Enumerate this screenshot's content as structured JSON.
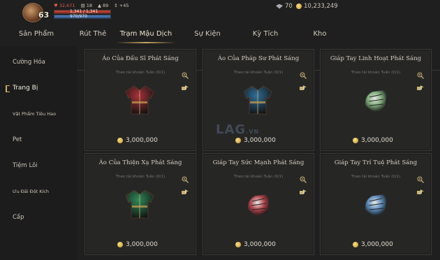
{
  "player": {
    "level": "63",
    "power": "32,671",
    "stat_a": "18",
    "stat_b": "89",
    "stat_c": "+45",
    "hp": "1,341 / 1,341",
    "mp": "970/970",
    "hp_fraction": 1.0,
    "mp_fraction": 1.0
  },
  "currency": {
    "gems": "70",
    "gold": "10,233,249"
  },
  "tabs": [
    {
      "label": "Sản Phẩm"
    },
    {
      "label": "Rút Thẻ"
    },
    {
      "label": "Trạm Mậu Dịch"
    },
    {
      "label": "Sự Kiện"
    },
    {
      "label": "Kỳ Tích"
    },
    {
      "label": "Kho"
    }
  ],
  "active_tab": "Trạm Mậu Dịch",
  "sidebar": {
    "items": [
      {
        "label": "Cường Hóa"
      },
      {
        "label": "Trang Bị"
      },
      {
        "label": "Vật Phẩm Tiêu Hao"
      },
      {
        "label": "Pet"
      },
      {
        "label": "Tiệm Lõi"
      },
      {
        "label": "Ưu Đãi Đột Kích"
      },
      {
        "label": "Cấp"
      }
    ],
    "active": "Trang Bị"
  },
  "items": [
    {
      "name": "Áo Của Đấu Sĩ Phát Sáng",
      "limit": "Theo tài khoản Tuần (0/1)",
      "price": "3,000,000",
      "kind": "robe",
      "color": "#a8323a"
    },
    {
      "name": "Áo Của Pháp Sư Phát Sáng",
      "limit": "Theo tài khoản Tuần (0/1)",
      "price": "3,000,000",
      "kind": "robe",
      "color": "#2f6e98"
    },
    {
      "name": "Giáp Tay Linh Hoạt Phát Sáng",
      "limit": "Theo tài khoản Tuần (0/1)",
      "price": "3,000,000",
      "kind": "gauntlet",
      "color": "#7faa7a"
    },
    {
      "name": "Áo Của Thiện Xạ Phát Sáng",
      "limit": "Theo tài khoản Tuần (0/1)",
      "price": "3,000,000",
      "kind": "robe",
      "color": "#2f8a5a"
    },
    {
      "name": "Giáp Tay Sức Mạnh Phát Sáng",
      "limit": "Theo tài khoản Tuần (0/1)",
      "price": "3,000,000",
      "kind": "gauntlet",
      "color": "#b0444a"
    },
    {
      "name": "Giáp Tay Trí Tuệ Phát Sáng",
      "limit": "Theo tài khoản Tuần (0/1)",
      "price": "3,000,000",
      "kind": "gauntlet",
      "color": "#5a8ab8"
    }
  ],
  "watermark": {
    "main": "LAG",
    "suffix": ".VN"
  }
}
